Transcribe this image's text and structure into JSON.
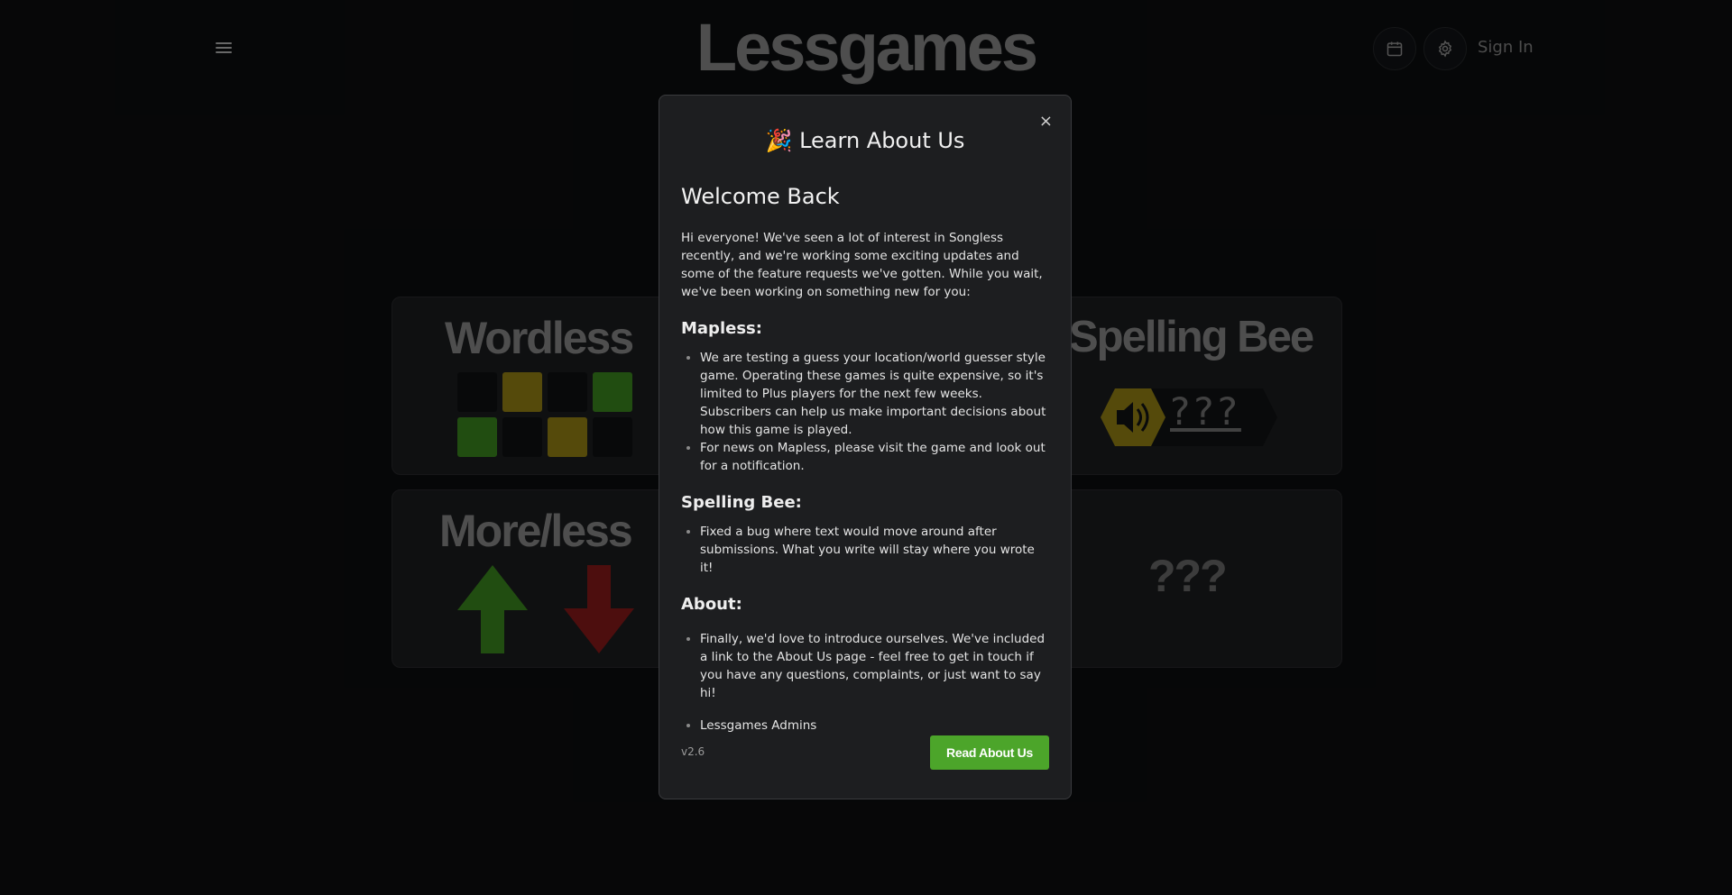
{
  "header": {
    "logo": "Lessgames",
    "signin_label": "Sign In",
    "icons": [
      "menu-icon",
      "calendar-icon",
      "gear-icon"
    ]
  },
  "tiles": {
    "wordless_title": "Wordless",
    "spelling_bee_title": "Spelling Bee",
    "spelling_bee_placeholder": "???",
    "moreless_title": "More/less",
    "mystery_title": "???"
  },
  "modal": {
    "title": "🎉 Learn About Us",
    "welcome": "Welcome Back",
    "intro": "Hi everyone! We've seen a lot of interest in Songless recently, and we're working some exciting updates and some of the feature requests we've gotten. While you wait, we've been working on something new for you:",
    "sections": [
      {
        "heading": "Mapless:",
        "items": [
          "We are testing a guess your location/world guesser style game. Operating these games is quite expensive, so it's limited to Plus players for the next few weeks. Subscribers can help us make important decisions about how this game is played.",
          "For news on Mapless, please visit the game and look out for a notification."
        ]
      },
      {
        "heading": "Spelling Bee:",
        "items": [
          "Fixed a bug where text would move around after submissions. What you write will stay where you wrote it!"
        ]
      },
      {
        "heading": "About:",
        "items": [
          "Finally, we'd love to introduce ourselves. We've included a link to the About Us page - feel free to get in touch if you have any questions, complaints, or just want to say hi!",
          "Lessgames Admins"
        ]
      }
    ],
    "version": "v2.6",
    "read_button": "Read About Us",
    "close_label": "×"
  },
  "colors": {
    "accent_green": "#4ca52a",
    "tile_yellow": "#9b8714",
    "tile_green": "#3d8c1f",
    "arrow_red": "#8c1a1a"
  }
}
